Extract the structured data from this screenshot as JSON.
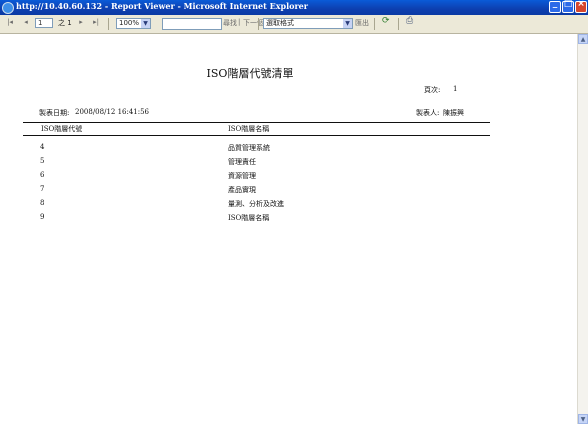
{
  "window": {
    "title": "http://10.40.60.132 - Report Viewer - Microsoft Internet Explorer"
  },
  "toolbar": {
    "first_icon": "first-page-icon",
    "prev_icon": "prev-page-icon",
    "page_value": "1",
    "page_of": "之 1",
    "next_icon": "next-page-icon",
    "last_icon": "last-page-icon",
    "zoom_value": "100%",
    "find_value": "",
    "find_label": "尋找",
    "find_next_label": "下一個",
    "export_value": "選取格式",
    "export_label": "匯出",
    "refresh_icon": "refresh-icon",
    "print_icon": "print-icon"
  },
  "report": {
    "title": "ISO階層代號清單",
    "page_label": "頁次:",
    "page_number": "1",
    "date_label": "製表日期:",
    "date_value": "2008/08/12 16:41:56",
    "author_label": "製表人:",
    "author_value": "陳振興",
    "columns": [
      "ISO階層代號",
      "ISO階層名稱"
    ],
    "rows": [
      {
        "code": "4",
        "name": "品質管理系統"
      },
      {
        "code": "5",
        "name": "管理責任"
      },
      {
        "code": "6",
        "name": "資源管理"
      },
      {
        "code": "7",
        "name": "產品實現"
      },
      {
        "code": "8",
        "name": "量測、分析及改進"
      },
      {
        "code": "9",
        "name": "ISO階層名稱"
      }
    ]
  }
}
